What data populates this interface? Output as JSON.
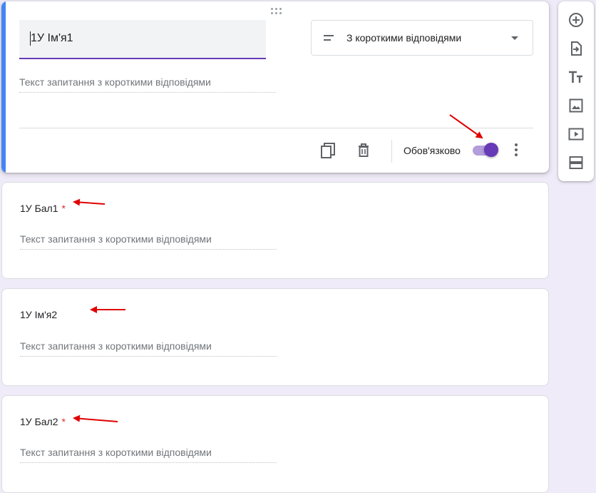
{
  "active_question": {
    "title": "1У Ім'я1",
    "type_label": "З короткими відповідями",
    "answer_placeholder": "Текст запитання з короткими відповідями",
    "required_label": "Обов'язково",
    "required": true
  },
  "questions": [
    {
      "title": "1У Бал1",
      "required_star": "*",
      "answer_placeholder": "Текст запитання з короткими відповідями"
    },
    {
      "title": "1У Ім'я2",
      "required_star": "",
      "answer_placeholder": "Текст запитання з короткими відповідями"
    },
    {
      "title": "1У Бал2",
      "required_star": "*",
      "answer_placeholder": "Текст запитання з короткими відповідями"
    }
  ],
  "toolbar": {
    "tools": [
      "add-question-icon",
      "import-questions-icon",
      "add-title-icon",
      "add-image-icon",
      "add-video-icon",
      "add-section-icon"
    ]
  },
  "colors": {
    "accent": "#673ab7",
    "active_bar": "#4285f4",
    "background": "#f0ebf8",
    "required_star": "#d93025",
    "annotation_arrow": "#e00000"
  }
}
